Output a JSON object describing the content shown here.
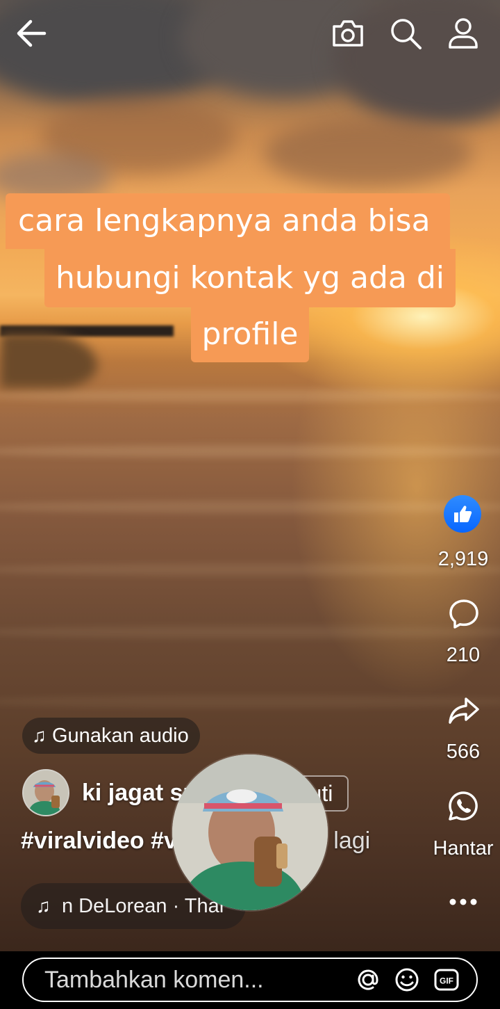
{
  "topbar": {
    "back_icon": "arrow-left-icon",
    "camera_icon": "camera-icon",
    "search_icon": "search-icon",
    "profile_icon": "profile-icon"
  },
  "caption": {
    "line1": "cara lengkapnya anda bisa",
    "line2": "hubungi kontak yg ada di",
    "line3": "profile",
    "background_color": "#f69a55"
  },
  "actions": {
    "like_count": "2,919",
    "comment_count": "210",
    "share_count": "566",
    "send_label": "Hantar",
    "like_color": "#0866ff"
  },
  "audio": {
    "use_audio_label": "Gunakan audio"
  },
  "author": {
    "name": "ki jagat sup...",
    "follow_label": "Ikuti"
  },
  "post": {
    "hashtags": "#viralvideo #viralreels #fy",
    "ellipsis": "...",
    "more_label": "lagi"
  },
  "music": {
    "track_text": "n DeLorean · Thar"
  },
  "comment_bar": {
    "placeholder": "Tambahkan komen...",
    "mention_icon": "at-icon",
    "emoji_icon": "emoji-icon",
    "gif_icon": "gif-icon"
  }
}
